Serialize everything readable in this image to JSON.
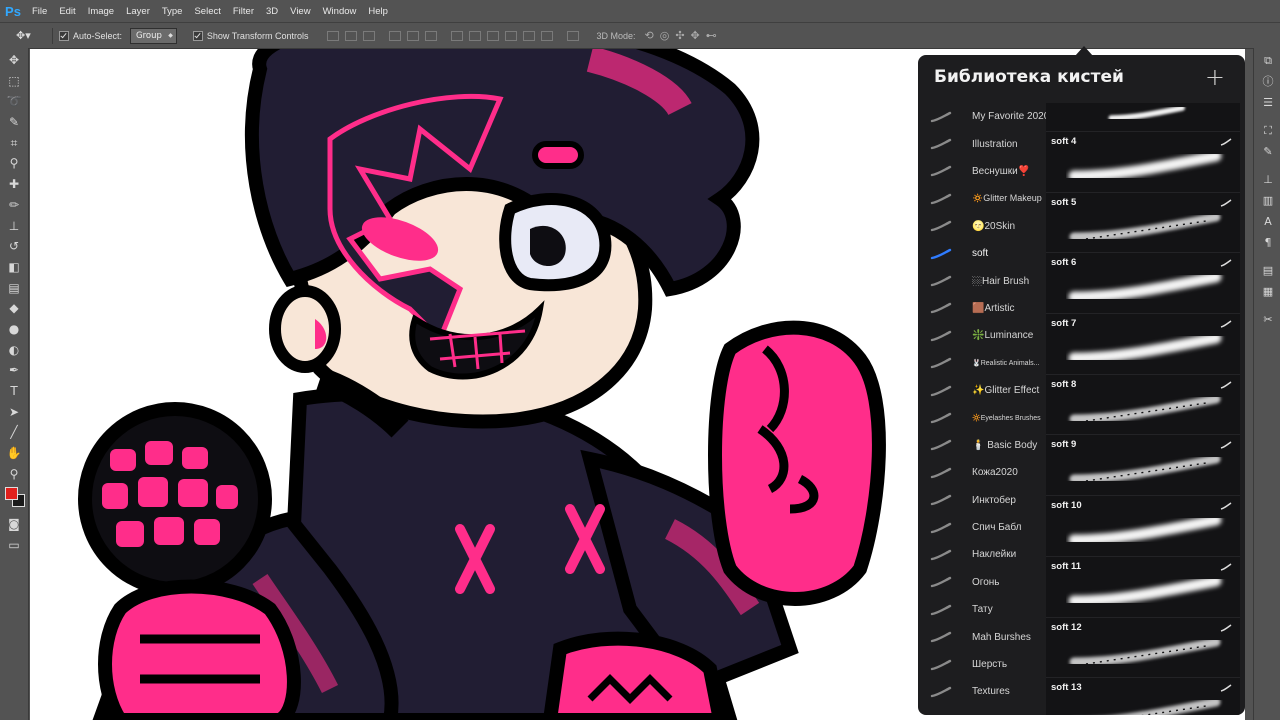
{
  "app": {
    "logo": "Ps"
  },
  "menu": [
    "File",
    "Edit",
    "Image",
    "Layer",
    "Type",
    "Select",
    "Filter",
    "3D",
    "View",
    "Window",
    "Help"
  ],
  "options": {
    "auto_select_label": "Auto-Select:",
    "auto_select_value": "Group",
    "show_transform_label": "Show Transform Controls",
    "mode_label": "3D Mode:"
  },
  "colors": {
    "foreground": "#e0201c",
    "background": "#1a1a1a",
    "accent": "#ff2d8a",
    "panel": "#1d1d1f"
  },
  "panel": {
    "title": "Библиотека кистей",
    "add_icon": "plus-icon",
    "libraries": [
      {
        "label": "My Favorite 2020"
      },
      {
        "label": "Illustration"
      },
      {
        "label": "Веснушки❣️"
      },
      {
        "label": "🔅Glitter Makeup",
        "small": true
      },
      {
        "label": "🌝20Skin"
      },
      {
        "label": "soft",
        "active": true
      },
      {
        "label": "🏼Hair Brush"
      },
      {
        "label": "🟫Artistic"
      },
      {
        "label": "❇️Luminance"
      },
      {
        "label": "🐰Realistic Animals...",
        "tiny": true
      },
      {
        "label": "✨Glitter Effect"
      },
      {
        "label": "🔆Eyelashes Brushes",
        "tiny": true
      },
      {
        "label": "🕯️ Basic Body"
      },
      {
        "label": "Кожа2020"
      },
      {
        "label": "Инктобер"
      },
      {
        "label": "Спич Бабл"
      },
      {
        "label": "Наклейки"
      },
      {
        "label": "Огонь"
      },
      {
        "label": "Тату"
      },
      {
        "label": "Mah Burshes"
      },
      {
        "label": "Шерсть"
      },
      {
        "label": "Textures"
      }
    ],
    "brushes": [
      {
        "name": ""
      },
      {
        "name": "soft 4"
      },
      {
        "name": "soft 5"
      },
      {
        "name": "soft 6"
      },
      {
        "name": "soft 7"
      },
      {
        "name": "soft 8"
      },
      {
        "name": "soft 9"
      },
      {
        "name": "soft 10"
      },
      {
        "name": "soft 11"
      },
      {
        "name": "soft 12"
      },
      {
        "name": "soft 13"
      }
    ]
  }
}
